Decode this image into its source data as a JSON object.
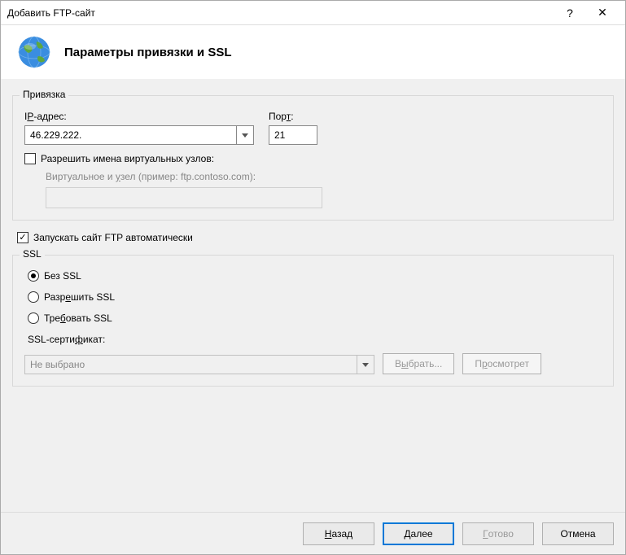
{
  "window": {
    "title": "Добавить FTP-сайт",
    "help": "?",
    "close": "✕"
  },
  "header": {
    "title": "Параметры привязки и SSL"
  },
  "binding": {
    "legend": "Привязка",
    "ip_label_pre": "I",
    "ip_label_u": "P",
    "ip_label_post": "-адрес:",
    "ip_value": "46.229.222.",
    "port_label_pre": "Пор",
    "port_label_u": "т",
    "port_label_post": ":",
    "port_value": "21",
    "virtual_hosts_label": "Разрешить имена виртуальных узлов:",
    "virtual_host_field_pre": "Виртуальное и ",
    "virtual_host_field_u": "у",
    "virtual_host_field_post": "зел (пример: ftp.contoso.com):"
  },
  "autostart": {
    "label": "Запускать сайт FTP автоматически"
  },
  "ssl": {
    "legend": "SSL",
    "no_ssl": "Без SSL",
    "allow_ssl_pre": "Разр",
    "allow_ssl_u": "е",
    "allow_ssl_post": "шить SSL",
    "require_ssl_pre": "Тре",
    "require_ssl_u": "б",
    "require_ssl_post": "овать SSL",
    "cert_label_pre": "SSL-серти",
    "cert_label_u": "ф",
    "cert_label_post": "икат:",
    "cert_value": "Не выбрано",
    "select_btn_pre": "В",
    "select_btn_u": "ы",
    "select_btn_post": "брать...",
    "view_btn_pre": "П",
    "view_btn_u": "р",
    "view_btn_post": "осмотрет"
  },
  "footer": {
    "back_pre": "",
    "back_u": "Н",
    "back_post": "азад",
    "next_pre": "",
    "next_u": "Д",
    "next_post": "алее",
    "finish_pre": "",
    "finish_u": "Г",
    "finish_post": "отово",
    "cancel": "Отмена"
  }
}
